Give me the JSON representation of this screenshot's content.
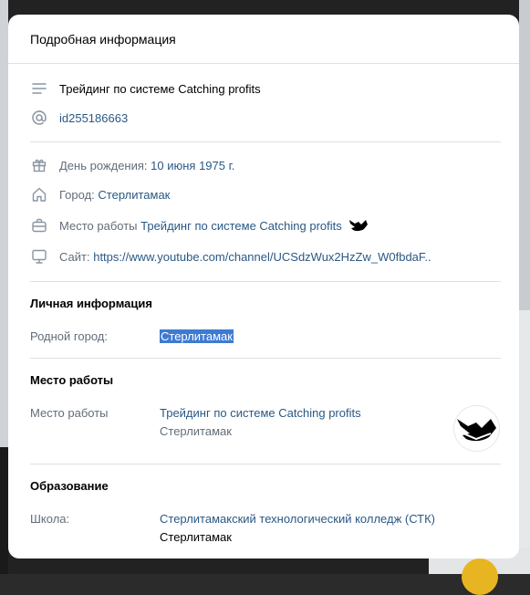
{
  "modal": {
    "title": "Подробная информация"
  },
  "summary": {
    "status": "Трейдинг по системе Catching profits",
    "screen_name": "id255186663",
    "birthday_label": "День рождения:",
    "birthday_value": "10 июня 1975 г.",
    "city_label": "Город:",
    "city_value": "Стерлитамак",
    "work_label": "Место работы",
    "work_value": "Трейдинг по системе Catching profits",
    "site_label": "Сайт:",
    "site_value": "https://www.youtube.com/channel/UCSdzWux2HzZw_W0fbdaF.."
  },
  "personal": {
    "title": "Личная информация",
    "hometown_label": "Родной город:",
    "hometown_value": "Стерлитамак"
  },
  "work": {
    "title": "Место работы",
    "label": "Место работы",
    "company": "Трейдинг по системе Catching profits",
    "city": "Стерлитамак"
  },
  "education": {
    "title": "Образование",
    "school_label": "Школа:",
    "school_value": "Стерлитамакский технологический колледж (СТК)",
    "school_city": "Стерлитамак"
  },
  "icons": {
    "status": "lines-icon",
    "screen_name": "at-icon",
    "birthday": "gift-icon",
    "city": "home-icon",
    "work": "briefcase-icon",
    "site": "monitor-icon"
  },
  "colors": {
    "link": "#2a5885",
    "muted": "#626d7a",
    "selection": "#3f7ad1"
  }
}
